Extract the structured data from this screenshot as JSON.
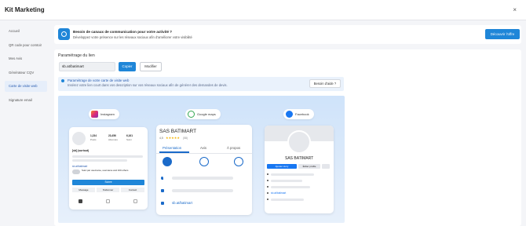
{
  "window": {
    "title": "Kit Marketing",
    "close": "×"
  },
  "sidebar": {
    "items": [
      {
        "label": "Accueil"
      },
      {
        "label": "QR code pour comtoir"
      },
      {
        "label": "Mes Avis"
      },
      {
        "label": "Générateur CQV"
      },
      {
        "label": "Carte de visite web"
      },
      {
        "label": "Signature email"
      }
    ]
  },
  "banner": {
    "title": "Besoin de canaux de communication pour votre activité ?",
    "subtitle": "Développez votre présence sur les réseaux sociaux afin d'améliorer votre visibilité",
    "cta": "Découvrir l'offre"
  },
  "settings": {
    "title": "Paramétrage du lien",
    "url_value": "sb.at/batimart",
    "copy_label": "Copier",
    "edit_label": "Modifier"
  },
  "info": {
    "line1": "Paramétrage de votre carte de visite web",
    "line2": "Insérez votre lien court dans vos description sur vos réseaux sociaux afin de générer des demandes de devis.",
    "help_label": "Besoin d'aide ?"
  },
  "preview": {
    "instagram": {
      "label": "Instagram",
      "stats": [
        {
          "value": "1,234",
          "label": "Posts"
        },
        {
          "value": "23,456",
          "label": "Abonnés"
        },
        {
          "value": "6,161",
          "label": "Suivi"
        }
      ],
      "bio": "[sb] (surtout)",
      "link": "sb.at/batimart",
      "followed": "Suivi par username, username and 100 others",
      "follow_btn": "Suivre",
      "actions": [
        "Message",
        "S'abonner",
        "Contact"
      ]
    },
    "maps": {
      "label": "Google maps",
      "company": "SAS BATIMART",
      "rating": "4,5",
      "stars": "★★★★★",
      "count": "(58)",
      "tabs": [
        "Présentation",
        "Avis",
        "À propos"
      ],
      "link": "sb.at/batimart"
    },
    "facebook": {
      "label": "Facebook",
      "company": "SAS BATIMART",
      "btn1": "Ajouter story",
      "btn2": "Éditer profile",
      "link": "sb.at/batimart"
    }
  },
  "colors": {
    "accent": "#1f86d8",
    "instagram": "#c13584",
    "facebook": "#1877f2",
    "stars": "#f5b400"
  }
}
